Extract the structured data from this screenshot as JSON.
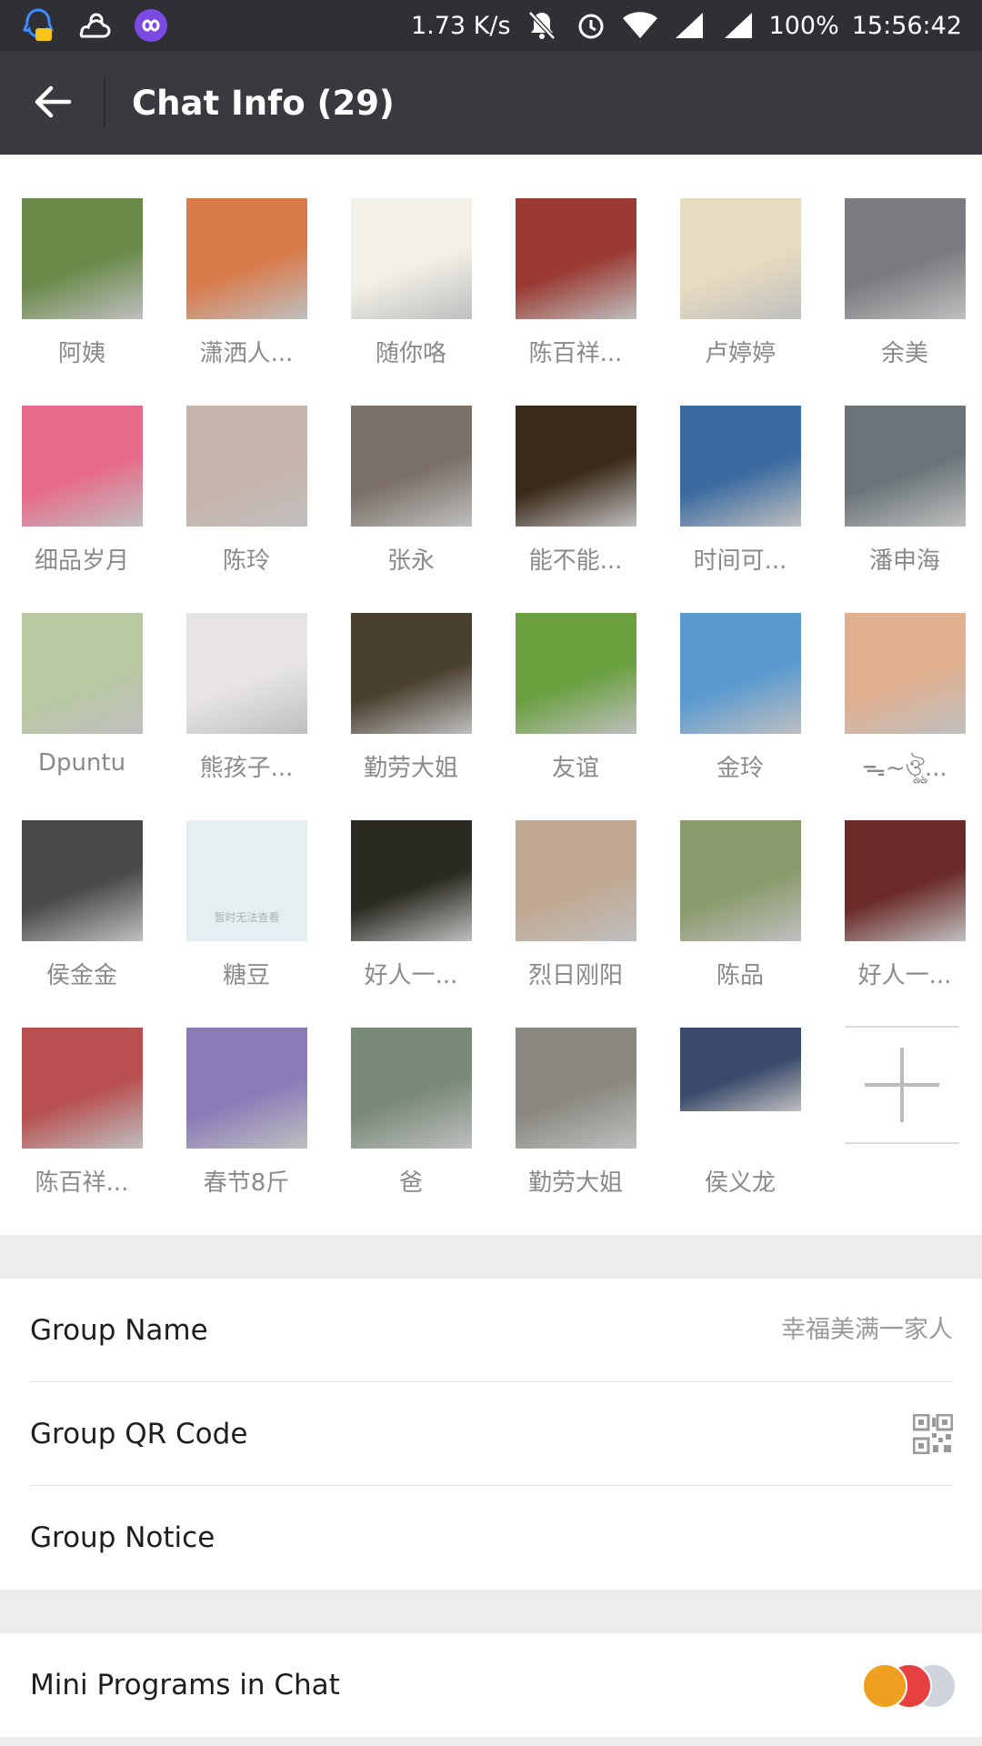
{
  "status_bar": {
    "speed": "1.73 K/s",
    "battery": "100%",
    "time": "15:56:42",
    "icons": [
      "qq-notification-icon",
      "weather-sun-cloud-icon",
      "app-loop-icon",
      "mute-bell-icon",
      "alarm-icon",
      "wifi-icon",
      "signal-icon",
      "signal-icon-2"
    ]
  },
  "header": {
    "title": "Chat Info (29)",
    "back_icon": "arrow-left-icon"
  },
  "members": [
    {
      "name": "阿姨",
      "color": "#6a8a4a"
    },
    {
      "name": "潇洒人...",
      "color": "#d97a4a"
    },
    {
      "name": "随你咯",
      "color": "#f2efe6"
    },
    {
      "name": "陈百祥...",
      "color": "#9a3a32"
    },
    {
      "name": "卢婷婷",
      "color": "#e8dcc0"
    },
    {
      "name": "余美",
      "color": "#7a7a80"
    },
    {
      "name": "细品岁月",
      "color": "#e86a8a"
    },
    {
      "name": "陈玲",
      "color": "#c8b4aa"
    },
    {
      "name": "张永",
      "color": "#7a7068"
    },
    {
      "name": "能不能...",
      "color": "#3a2a18"
    },
    {
      "name": "时间可...",
      "color": "#3a6aa0"
    },
    {
      "name": "潘申海",
      "color": "#6a7478"
    },
    {
      "name": "Dpuntu",
      "color": "#b8c8a0"
    },
    {
      "name": "熊孩子...",
      "color": "#e8e4e4"
    },
    {
      "name": "勤劳大姐",
      "color": "#4a4030"
    },
    {
      "name": "友谊",
      "color": "#6aa040"
    },
    {
      "name": "金玲",
      "color": "#5a9ad0"
    },
    {
      "name": "ᯓ~ঔৣ...",
      "color": "#e0b090"
    },
    {
      "name": "侯金金",
      "color": "#4a4a4a"
    },
    {
      "name": "糖豆",
      "color": "#e4ecf0"
    },
    {
      "name": "好人一...",
      "color": "#2a2a22"
    },
    {
      "name": "烈日刚阳",
      "color": "#c0a890"
    },
    {
      "name": "陈品",
      "color": "#8a9a6a"
    },
    {
      "name": "好人一...",
      "color": "#6a2a28"
    },
    {
      "name": "陈百祥...",
      "color": "#b85050"
    },
    {
      "name": "春节8斤",
      "color": "#8a7ab8"
    },
    {
      "name": "爸",
      "color": "#7a8a78"
    },
    {
      "name": "勤劳大姐",
      "color": "#8a8880"
    },
    {
      "name": "侯义龙",
      "color": "#3a4a6a"
    }
  ],
  "placeholder_avatar_text": "暂时无法查看",
  "add_member_icon": "plus-icon",
  "settings": {
    "group_name_label": "Group Name",
    "group_name_value": "幸福美满一家人",
    "group_qr_label": "Group QR Code",
    "qr_icon": "qr-code-icon",
    "group_notice_label": "Group Notice",
    "mini_programs_label": "Mini Programs in Chat",
    "mini_program_icons": [
      "mini-program-icon-1",
      "mini-program-icon-2",
      "mini-program-icon-3"
    ]
  },
  "colors": {
    "status_bar": "#2e3035",
    "app_bar": "#393a3f",
    "section_gap": "#ececec",
    "member_name": "#8a8a8a"
  }
}
